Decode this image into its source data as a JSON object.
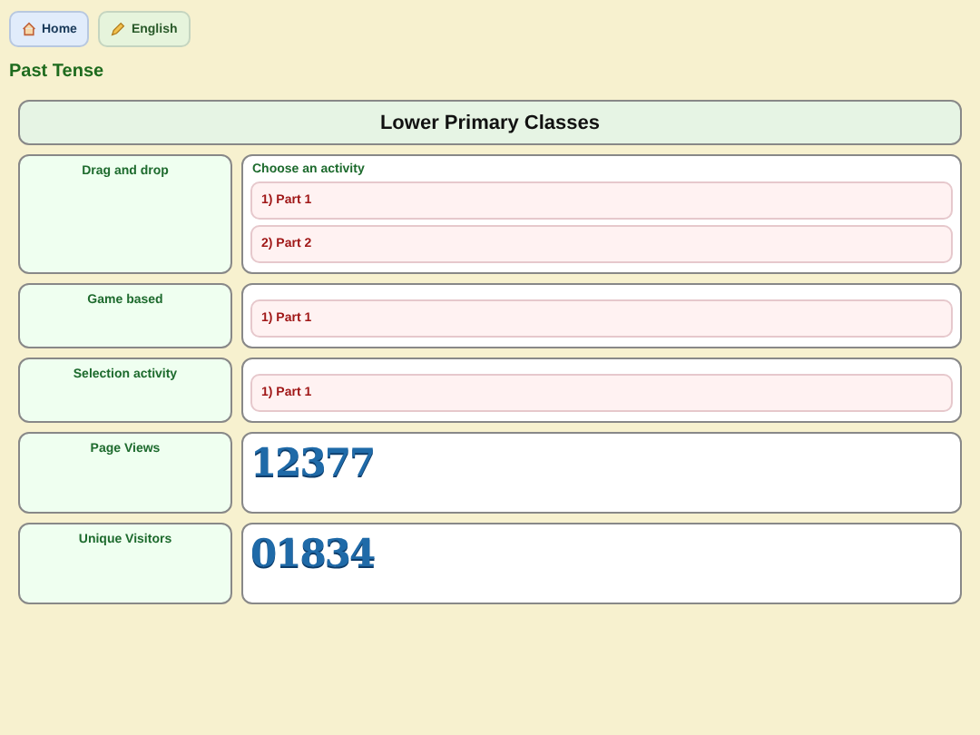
{
  "nav": [
    {
      "label": "Home",
      "kind": "home"
    },
    {
      "label": "English",
      "kind": "subject"
    }
  ],
  "page_title": "Past Tense",
  "section_title": "Lower Primary Classes",
  "rows": [
    {
      "label": "Drag and drop",
      "kind": "activities",
      "heading": "Choose an activity",
      "items": [
        "1) Part 1",
        "2) Part 2"
      ]
    },
    {
      "label": "Game based",
      "kind": "activities",
      "items": [
        "1) Part 1"
      ]
    },
    {
      "label": "Selection activity",
      "kind": "activities",
      "items": [
        "1) Part 1"
      ]
    },
    {
      "label": "Page Views",
      "kind": "counter",
      "value": "12377"
    },
    {
      "label": "Unique Visitors",
      "kind": "counter",
      "value": "01834"
    }
  ]
}
